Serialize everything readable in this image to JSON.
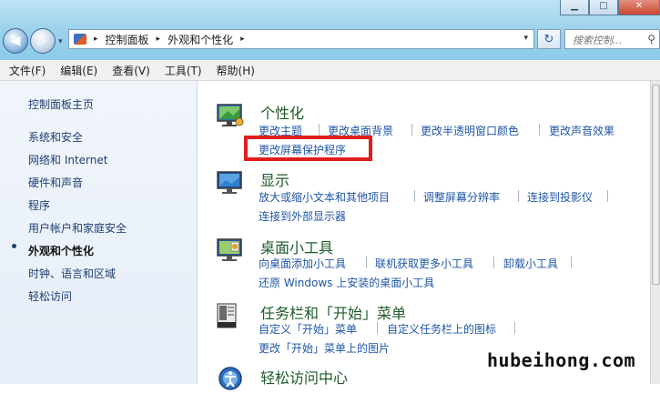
{
  "window": {
    "min_label": "▁",
    "max_label": "□",
    "close_label": "✕"
  },
  "nav": {
    "back_label": "◀",
    "forward_label": "▶",
    "recent_label": "▾",
    "refresh_label": "↻"
  },
  "address": {
    "segments": [
      "控制面板",
      "外观和个性化"
    ],
    "separator": "▸",
    "dropdown": "▾"
  },
  "search": {
    "placeholder": "搜索控制...",
    "icon_label": "⚲"
  },
  "menu": {
    "items": [
      "文件(F)",
      "编辑(E)",
      "查看(V)",
      "工具(T)",
      "帮助(H)"
    ]
  },
  "sidebar": {
    "items": [
      {
        "label": "控制面板主页"
      },
      {
        "label": "系统和安全"
      },
      {
        "label": "网络和 Internet"
      },
      {
        "label": "硬件和声音"
      },
      {
        "label": "程序"
      },
      {
        "label": "用户帐户和家庭安全"
      },
      {
        "label": "外观和个性化",
        "active": true
      },
      {
        "label": "时钟、语言和区域"
      },
      {
        "label": "轻松访问"
      }
    ]
  },
  "categories": [
    {
      "title": "个性化",
      "links": [
        "更改主题",
        "更改桌面背景",
        "更改半透明窗口颜色",
        "更改声音效果",
        "更改屏幕保护程序"
      ]
    },
    {
      "title": "显示",
      "links": [
        "放大或缩小文本和其他项目",
        "调整屏幕分辨率",
        "连接到投影仪",
        "连接到外部显示器"
      ]
    },
    {
      "title": "桌面小工具",
      "links": [
        "向桌面添加小工具",
        "联机获取更多小工具",
        "卸载小工具",
        "还原 Windows 上安装的桌面小工具"
      ]
    },
    {
      "title": "任务栏和「开始」菜单",
      "links": [
        "自定义「开始」菜单",
        "自定义任务栏上的图标",
        "更改「开始」菜单上的图片"
      ]
    },
    {
      "title": "轻松访问中心",
      "links": []
    }
  ],
  "colors": {
    "highlight_box": "#e21d1d",
    "link": "#1f56a8",
    "category_title": "#1e5a2a"
  },
  "watermark": "hubeihong.com"
}
